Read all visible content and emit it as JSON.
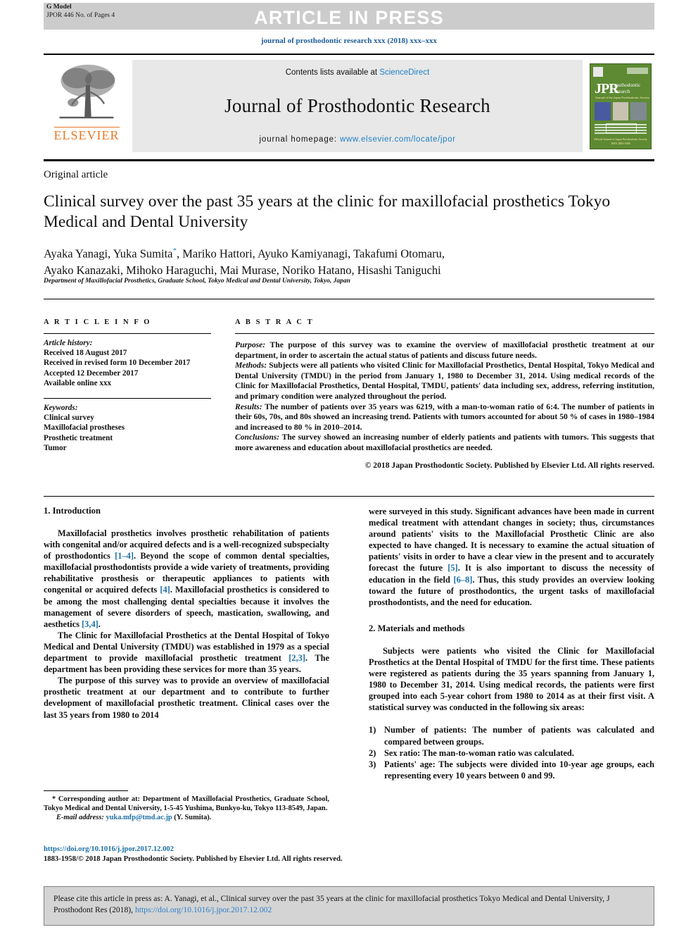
{
  "banner": {
    "gmodel_label": "G Model",
    "gmodel_sub": "JPOR 446 No. of Pages 4",
    "article_in_press": "ARTICLE IN PRESS"
  },
  "journal_line": "journal of prosthodontic research xxx (2018) xxx–xxx",
  "masthead": {
    "contents_prefix": "Contents lists available at ",
    "contents_link": "ScienceDirect",
    "journal_title": "Journal of Prosthodontic Research",
    "homepage_prefix": "journal homepage: ",
    "homepage_url": "www.elsevier.com/locate/jpor",
    "publisher_wordmark": "ELSEVIER",
    "cover": {
      "jpr": "JPR",
      "word1": "rosthodontic",
      "word2": "esearch",
      "subtitle": "Journal of the Japan Prosthodontic Society",
      "footer_line1": "Official Journal of Japan Prosthodontic Society",
      "footer_line2": "ISSN 1883-1958"
    }
  },
  "article": {
    "type": "Original article",
    "title": "Clinical survey over the past 35 years at the clinic for maxillofacial prosthetics Tokyo Medical and Dental University",
    "authors_line1": "Ayaka Yanagi, Yuka Sumita",
    "authors_star": "*",
    "authors_line1b": ", Mariko Hattori, Ayuko Kamiyanagi, Takafumi Otomaru,",
    "authors_line2": "Ayako Kanazaki, Mihoko Haraguchi, Mai Murase, Noriko Hatano, Hisashi Taniguchi",
    "affiliation": "Department of Maxillofacial Prosthetics, Graduate School, Tokyo Medical and Dental University, Tokyo, Japan"
  },
  "article_info": {
    "heading": "A R T I C L E   I N F O",
    "history_label": "Article history:",
    "history": [
      "Received 18 August 2017",
      "Received in revised form 10 December 2017",
      "Accepted 12 December 2017",
      "Available online xxx"
    ],
    "keywords_label": "Keywords:",
    "keywords": [
      "Clinical survey",
      "Maxillofacial prostheses",
      "Prosthetic treatment",
      "Tumor"
    ]
  },
  "abstract": {
    "heading": "A B S T R A C T",
    "purpose_label": "Purpose:",
    "purpose_text": " The purpose of this survey was to examine the overview of maxillofacial prosthetic treatment at our department, in order to ascertain the actual status of patients and discuss future needs.",
    "methods_label": "Methods:",
    "methods_text": " Subjects were all patients who visited Clinic for Maxillofacial Prosthetics, Dental Hospital, Tokyo Medical and Dental University (TMDU) in the period from January 1, 1980 to December 31, 2014. Using medical records of the Clinic for Maxillofacial Prosthetics, Dental Hospital, TMDU, patients' data including sex, address, referring institution, and primary condition were analyzed throughout the period.",
    "results_label": "Results:",
    "results_text": " The number of patients over 35 years was 6219, with a man-to-woman ratio of 6:4. The number of patients in their 60s, 70s, and 80s showed an increasing trend. Patients with tumors accounted for about 50 % of cases in 1980–1984 and increased to 80 % in 2010–2014.",
    "conclusions_label": "Conclusions:",
    "conclusions_text": " The survey showed an increasing number of elderly patients and patients with tumors. This suggests that more awareness and education about maxillofacial prosthetics are needed.",
    "copyright": "© 2018 Japan Prosthodontic Society. Published by Elsevier Ltd. All rights reserved."
  },
  "body": {
    "intro_heading": "1. Introduction",
    "intro_p1_a": "Maxillofacial prosthetics involves prosthetic rehabilitation of patients with congenital and/or acquired defects and is a well-recognized subspecialty of prosthodontics ",
    "intro_p1_ref1": "[1–4]",
    "intro_p1_b": ". Beyond the scope of common dental specialties, maxillofacial prosthodontists provide a wide variety of treatments, providing rehabilitative prosthesis or therapeutic appliances to patients with congenital or acquired defects ",
    "intro_p1_ref2": "[4]",
    "intro_p1_c": ". Maxillofacial prosthetics is considered to be among the most challenging dental specialties because it involves the management of severe disorders of speech, mastication, swallowing, and aesthetics ",
    "intro_p1_ref3": "[3,4]",
    "intro_p1_d": ".",
    "intro_p2_a": "The Clinic for Maxillofacial Prosthetics at the Dental Hospital of Tokyo Medical and Dental University (TMDU) was established in 1979 as a special department to provide maxillofacial prosthetic treatment ",
    "intro_p2_ref1": "[2,3]",
    "intro_p2_b": ". The department has been providing these services for more than 35 years.",
    "intro_p3": "The purpose of this survey was to provide an overview of maxillofacial prosthetic treatment at our department and to contribute to further development of maxillofacial prosthetic treatment. Clinical cases over the last 35 years from 1980 to 2014",
    "right_p1_a": "were surveyed in this study. Significant advances have been made in current medical treatment with attendant changes in society; thus, circumstances around patients' visits to the Maxillofacial Prosthetic Clinic are also expected to have changed. It is necessary to examine the actual situation of patients' visits in order to have a clear view in the present and to accurately forecast the future ",
    "right_p1_ref1": "[5]",
    "right_p1_b": ". It is also important to discuss the necessity of education in the field ",
    "right_p1_ref2": "[6–8]",
    "right_p1_c": ". Thus, this study provides an overview looking toward the future of prosthodontics, the urgent tasks of maxillofacial prosthodontists, and the need for education.",
    "methods_heading": "2. Materials and methods",
    "methods_p1": "Subjects were patients who visited the Clinic for Maxillofacial Prosthetics at the Dental Hospital of TMDU for the first time. These patients were registered as patients during the 35 years spanning from January 1, 1980 to December 31, 2014. Using medical records, the patients were first grouped into each 5-year cohort from 1980 to 2014 as at their first visit. A statistical survey was conducted in the following six areas:",
    "list": [
      {
        "num": "1)",
        "text": "Number of patients: The number of patients was calculated and compared between groups."
      },
      {
        "num": "2)",
        "text": "Sex ratio: The man-to-woman ratio was calculated."
      },
      {
        "num": "3)",
        "text": "Patients' age: The subjects were divided into 10-year age groups, each representing every 10 years between 0 and 99."
      }
    ]
  },
  "footnotes": {
    "star": "*",
    "corresponding": " Corresponding author at: Department of Maxillofacial Prosthetics, Graduate School, Tokyo Medical and Dental University, 1-5-45 Yushima, Bunkyo-ku, Tokyo 113-8549, Japan.",
    "email_label": "E-mail address:",
    "email": "yuka.mfp@tmd.ac.jp",
    "email_suffix": " (Y. Sumita).",
    "doi_url": "https://doi.org/10.1016/j.jpor.2017.12.002",
    "issn_line": "1883-1958/© 2018 Japan Prosthodontic Society. Published by Elsevier Ltd. All rights reserved."
  },
  "cite_box": {
    "text_before": "Please cite this article in press as: A. Yanagi, et al., Clinical survey over the past 35 years at the clinic for maxillofacial prosthetics Tokyo Medical and Dental University, J Prosthodont Res (2018), ",
    "doi": "https://doi.org/10.1016/j.jpor.2017.12.002"
  },
  "colors": {
    "link_blue": "#1d7fc4",
    "ref_blue": "#1d6fa5",
    "elsevier_orange": "#e87722",
    "banner_gray": "#cccccc",
    "masthead_gray": "#e8e8e8",
    "cite_gray": "#d4d4d4",
    "cover_green": "#5d8a33"
  }
}
